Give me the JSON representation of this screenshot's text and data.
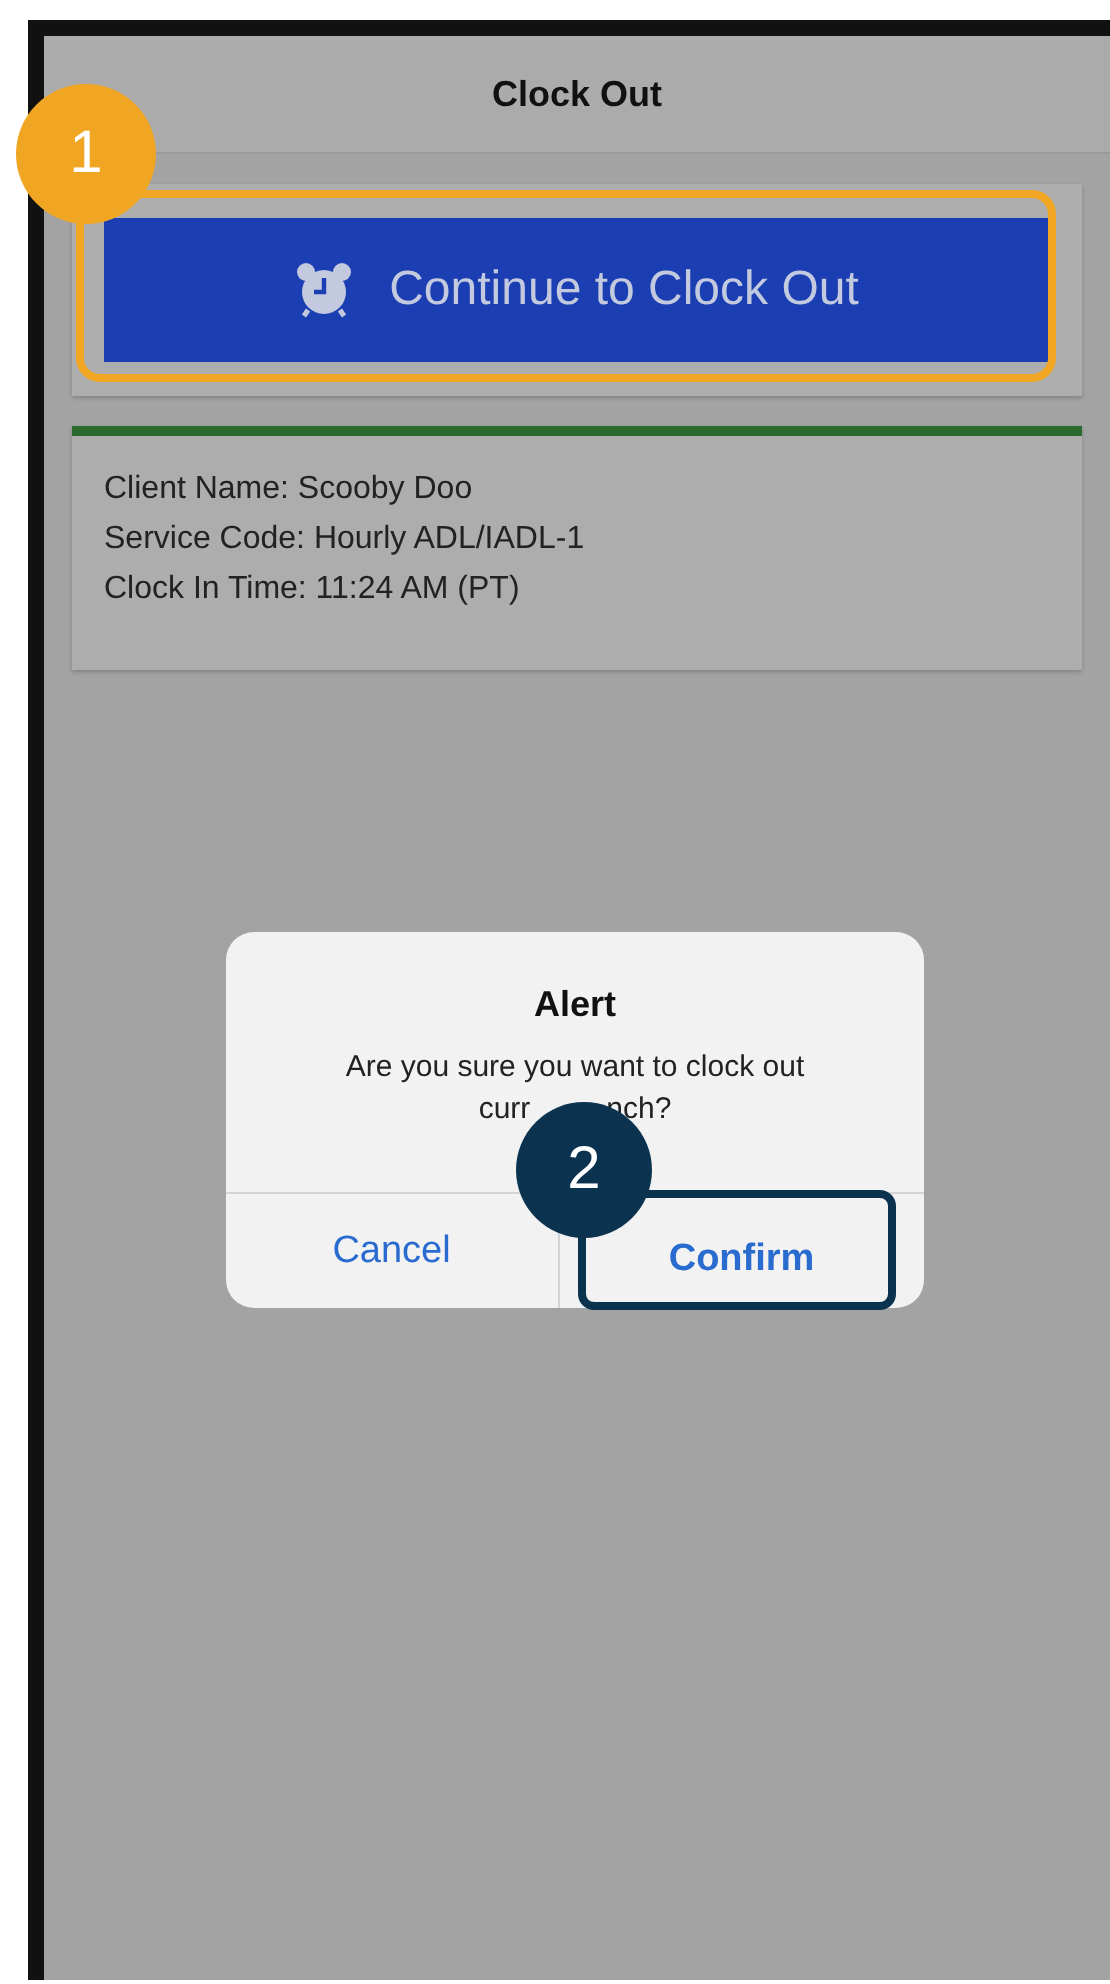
{
  "header": {
    "title": "Clock Out"
  },
  "clock_out_button": {
    "label": "Continue to Clock Out"
  },
  "visit_card": {
    "lines": [
      "Client Name: Scooby Doo",
      "Service Code: Hourly ADL/IADL-1",
      "Clock In Time: 11:24 AM (PT)"
    ]
  },
  "alert": {
    "title": "Alert",
    "message_line_1": "Are you sure you want to clock out",
    "message_line_2_start": "curr",
    "message_line_2_end": "nch?",
    "buttons": [
      {
        "label": "Cancel",
        "kind": "cancel"
      },
      {
        "label": "Confirm",
        "kind": "confirm"
      }
    ]
  },
  "callouts": [
    {
      "number": "1",
      "color": "#f0a623"
    },
    {
      "number": "2",
      "color": "#0b3350"
    }
  ]
}
